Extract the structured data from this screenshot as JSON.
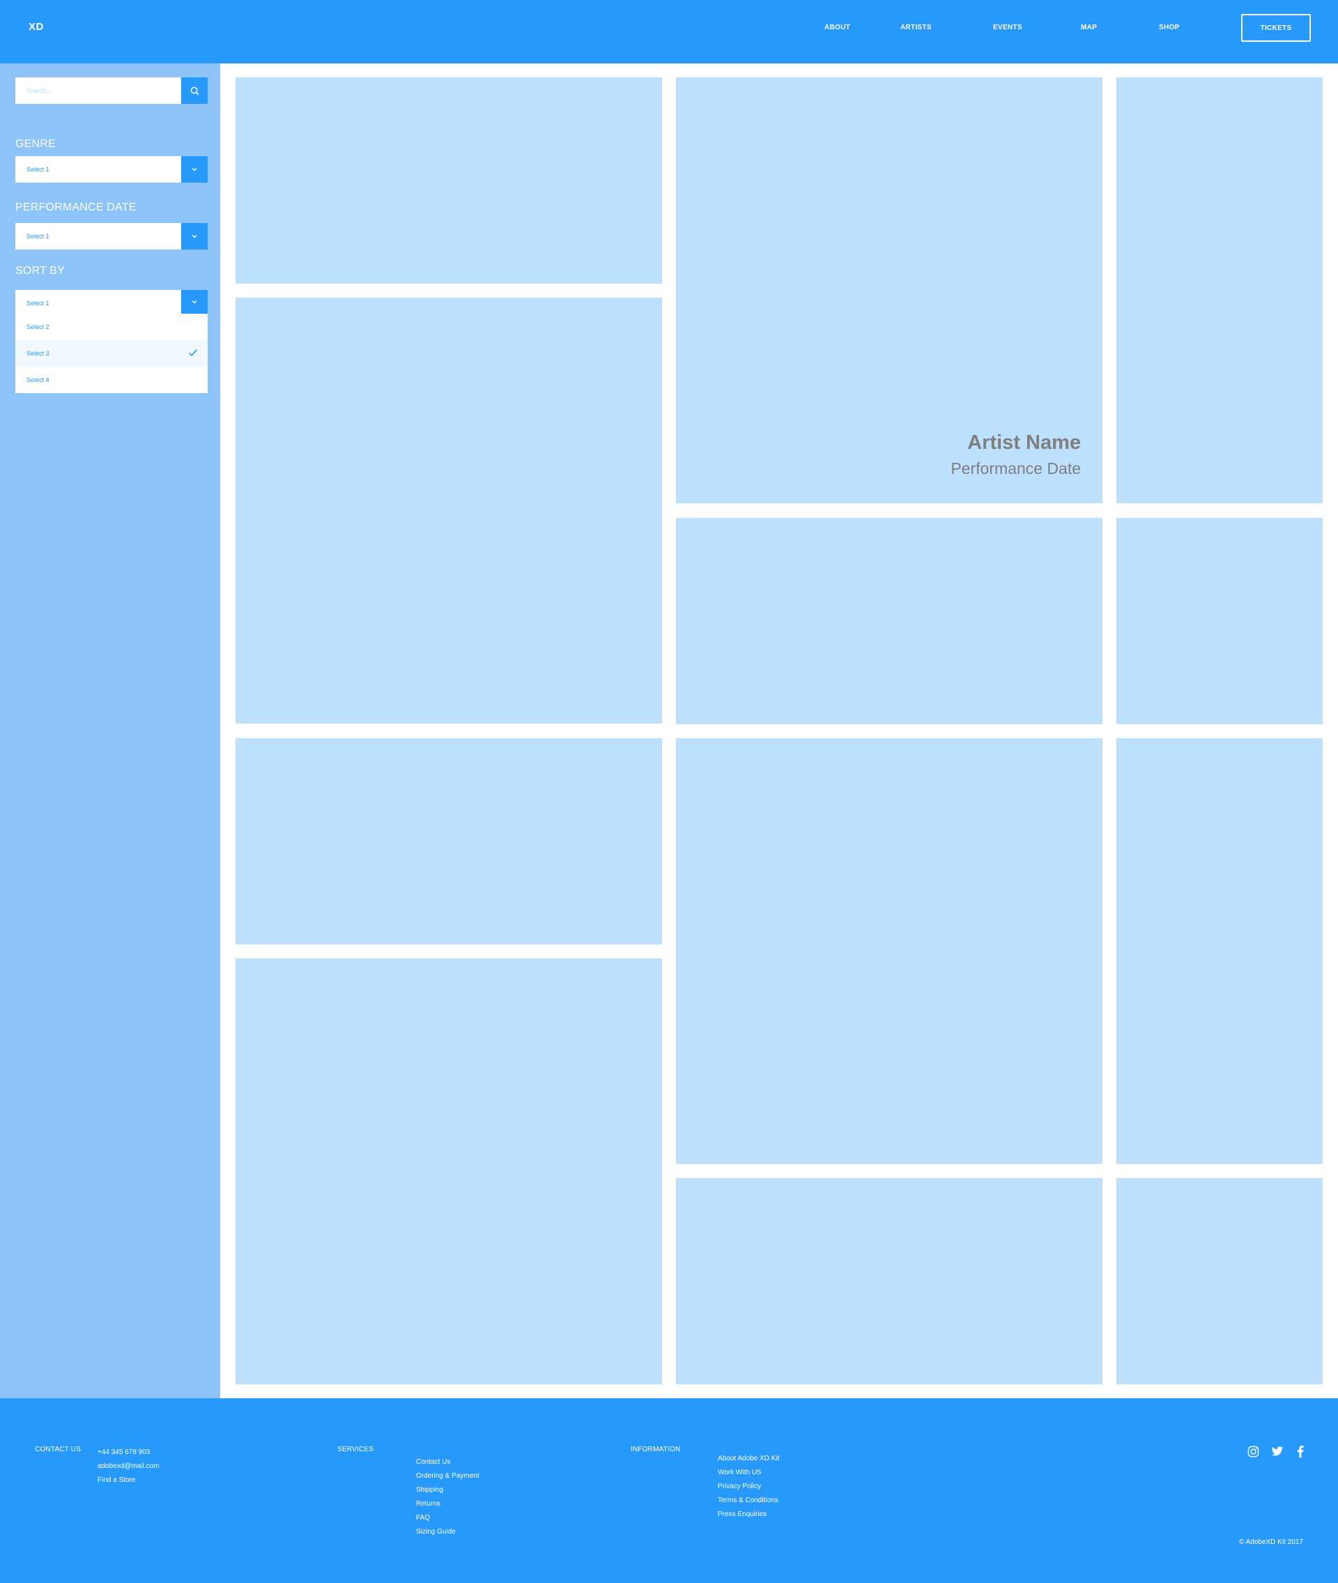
{
  "header": {
    "logo": "XD",
    "nav": [
      "ABOUT",
      "ARTISTS",
      "EVENTS",
      "MAP",
      "SHOP"
    ],
    "tickets": "TICKETS"
  },
  "sidebar": {
    "search_placeholder": "Search...",
    "genre": {
      "label": "GENRE",
      "value": "Select 1"
    },
    "performance_date": {
      "label": "PERFORMANCE DATE",
      "value": "Select 1"
    },
    "sort_by": {
      "label": "SORT BY",
      "value": "Select 1",
      "options": [
        "Select 2",
        "Select 3",
        "Select 4"
      ],
      "selected_option": "Select 3"
    }
  },
  "featured_tile": {
    "artist": "Artist Name",
    "date": "Performance Date"
  },
  "footer": {
    "contact": {
      "heading": "CONTACT US",
      "items": [
        "+44 345 678 903",
        "adobexd@mail.com",
        "Find a Store"
      ]
    },
    "services": {
      "heading": "SERVICES",
      "items": [
        "Contact Us",
        "Ordering & Payment",
        "Shipping",
        "Returns",
        "FAQ",
        "Sizing Guide"
      ]
    },
    "information": {
      "heading": "INFORMATION",
      "items": [
        "About Adobe XD Kit",
        "Work With US",
        "Privacy Policy",
        "Terms & Conditions",
        "Press Enquiries"
      ]
    },
    "social": [
      "instagram-icon",
      "twitter-icon",
      "facebook-icon"
    ],
    "copyright": "© AdobeXD Kit 2017"
  },
  "colors": {
    "primary": "#2699fb",
    "sidebar": "#8dc3f7",
    "tile": "#bce0fd",
    "tile_text": "#7f7f7f"
  }
}
